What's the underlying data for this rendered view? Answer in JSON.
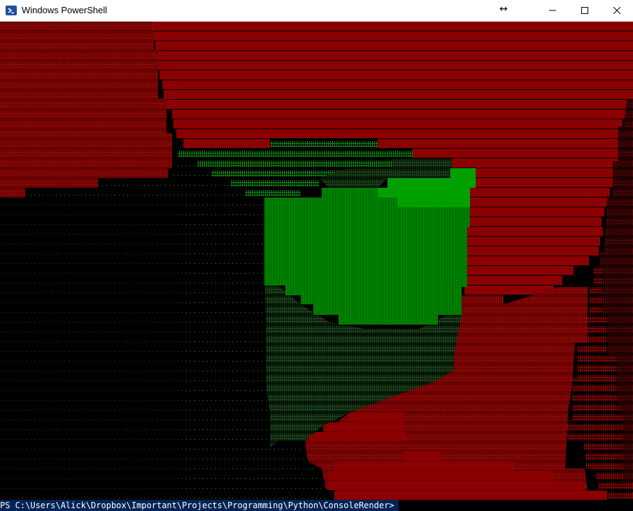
{
  "window": {
    "title": "Windows PowerShell",
    "resize_indicator": "↔",
    "buttons": {
      "minimize_icon": "minimize-icon",
      "maximize_icon": "maximize-icon",
      "close_icon": "close-icon"
    }
  },
  "console": {
    "prompt": "PS C:\\Users\\Alick\\Dropbox\\Important\\Projects\\Programming\\Python\\ConsoleRender>",
    "render_chars": [
      "#",
      "."
    ],
    "colors": {
      "background": "#000000",
      "prompt_background": "#012456",
      "dark_red": "#800000",
      "bright_red": "#a00000",
      "deep_red": "#3a0000",
      "green": "#008000",
      "bright_green": "#00a000",
      "dark_green": "#0b3d0b"
    }
  }
}
